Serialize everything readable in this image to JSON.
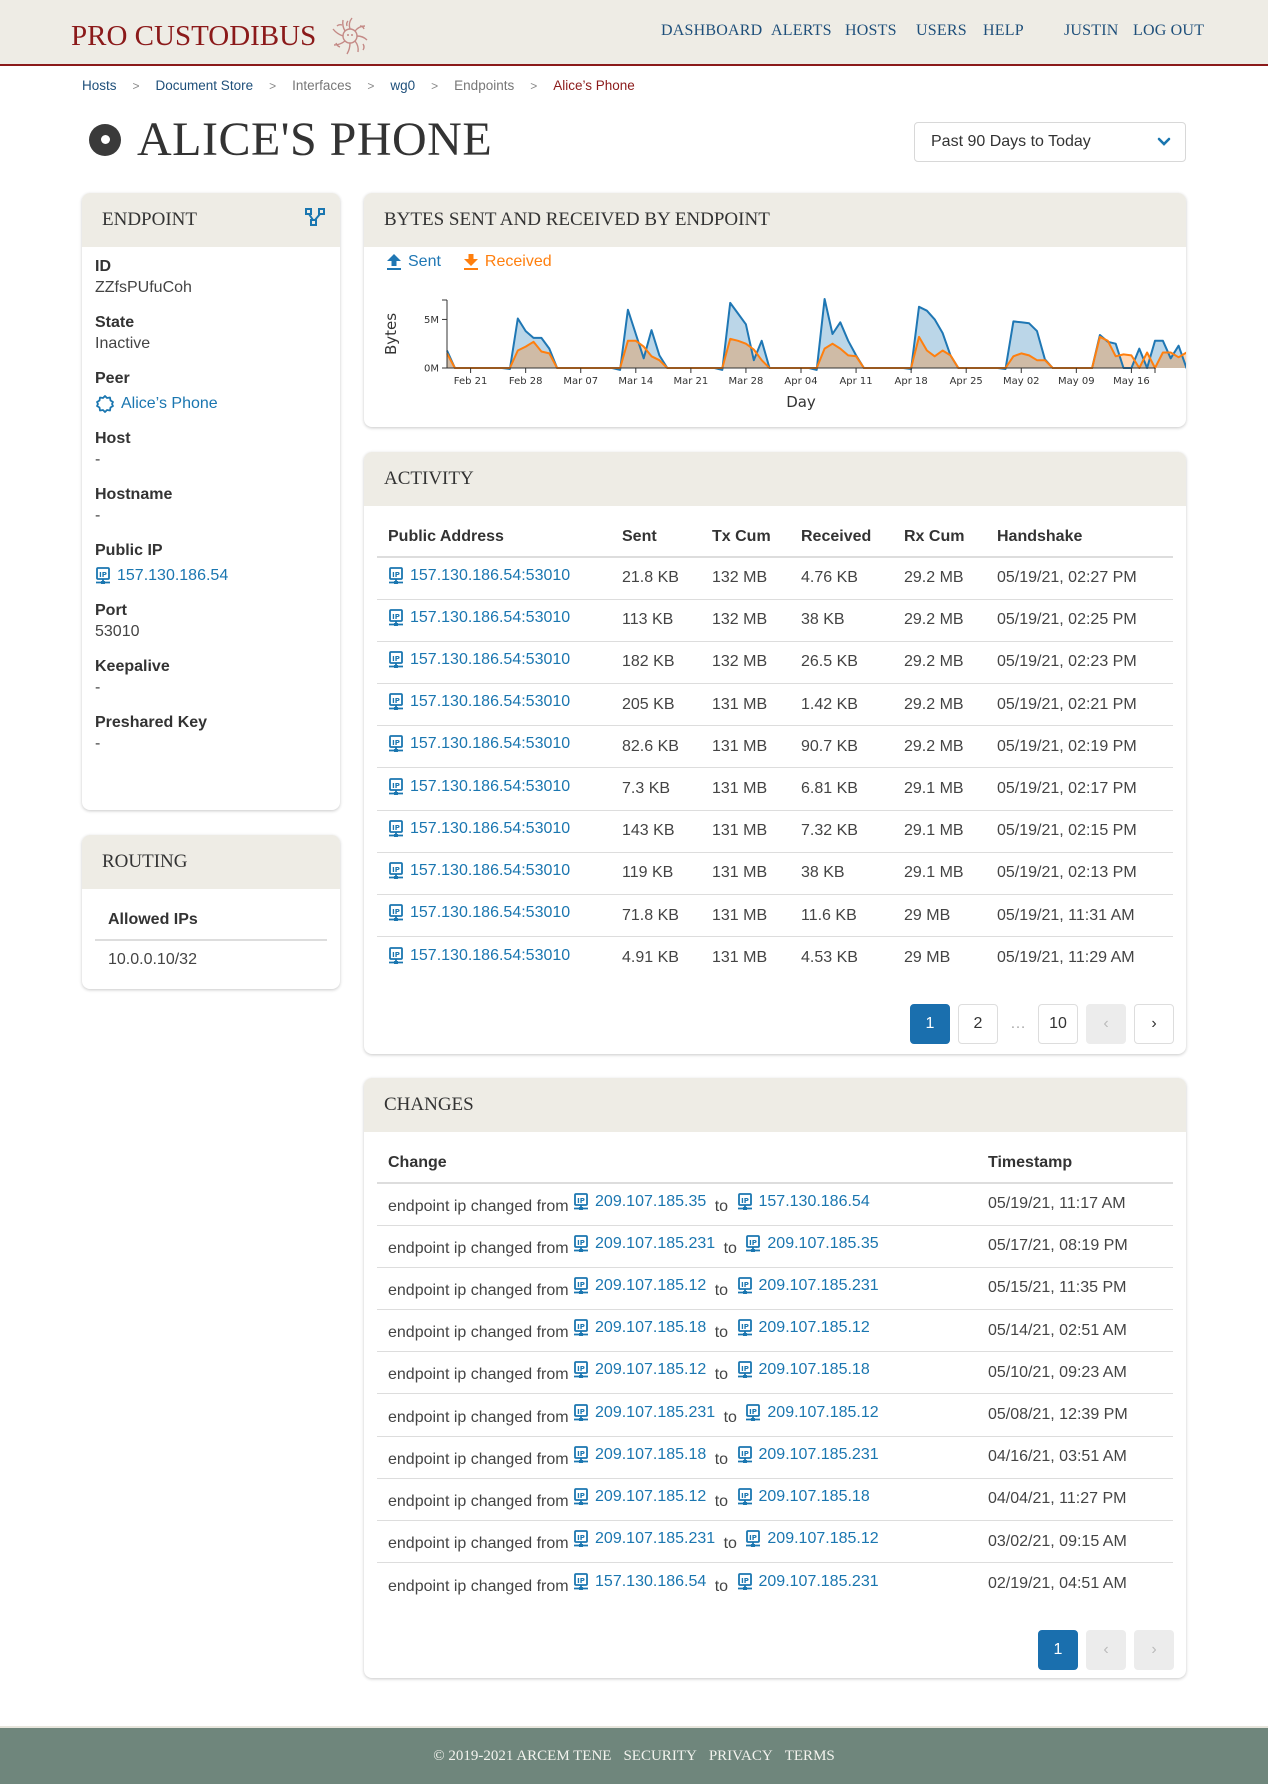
{
  "header": {
    "brand": "PRO CUSTODIBUS",
    "nav": [
      {
        "label": "DASHBOARD"
      },
      {
        "label": "ALERTS"
      },
      {
        "label": "HOSTS"
      },
      {
        "label": "USERS"
      },
      {
        "label": "HELP"
      }
    ],
    "user": "JUSTIN",
    "logout": "LOG OUT"
  },
  "breadcrumb": [
    {
      "label": "Hosts",
      "style": "link"
    },
    {
      "label": "Document Store",
      "style": "link"
    },
    {
      "label": "Interfaces",
      "style": "muted"
    },
    {
      "label": "wg0",
      "style": "link"
    },
    {
      "label": "Endpoints",
      "style": "muted"
    },
    {
      "label": "Alice’s Phone",
      "style": "current"
    }
  ],
  "breadcrumb_separator": ">",
  "page": {
    "title": "ALICE'S PHONE",
    "date_range": "Past 90 Days to Today"
  },
  "endpoint": {
    "heading": "ENDPOINT",
    "fields": {
      "id": {
        "label": "ID",
        "value": "ZZfsPUfuCoh"
      },
      "state": {
        "label": "State",
        "value": "Inactive"
      },
      "peer": {
        "label": "Peer",
        "value": "Alice’s Phone"
      },
      "host": {
        "label": "Host",
        "value": "-"
      },
      "hostname": {
        "label": "Hostname",
        "value": "-"
      },
      "public_ip": {
        "label": "Public IP",
        "value": "157.130.186.54"
      },
      "port": {
        "label": "Port",
        "value": "53010"
      },
      "keepalive": {
        "label": "Keepalive",
        "value": "-"
      },
      "preshared_key": {
        "label": "Preshared Key",
        "value": "-"
      }
    }
  },
  "routing": {
    "heading": "ROUTING",
    "column": "Allowed IPs",
    "rows": [
      "10.0.0.10/32"
    ]
  },
  "chart_panel": {
    "heading": "BYTES SENT AND RECEIVED BY ENDPOINT",
    "legend": [
      {
        "label": "Sent",
        "icon": "upload-arrow-icon",
        "color": "#1f77b4"
      },
      {
        "label": "Received",
        "icon": "download-arrow-icon",
        "color": "#ff7f0e"
      }
    ]
  },
  "chart_data": {
    "type": "area",
    "title": "BYTES SENT AND RECEIVED BY ENDPOINT",
    "xlabel": "Day",
    "ylabel": "Bytes",
    "x_start": "2021-02-18",
    "x_end": "2021-05-19",
    "x_ticks": [
      "Feb 21",
      "Feb 28",
      "Mar 07",
      "Mar 14",
      "Mar 21",
      "Mar 28",
      "Apr 04",
      "Apr 11",
      "Apr 18",
      "Apr 25",
      "May 02",
      "May 09",
      "May 16"
    ],
    "y_ticks": [
      "0M",
      "5M"
    ],
    "y_tick_values": [
      0,
      5
    ],
    "ylim": [
      0,
      7
    ],
    "y_unit": "M bytes",
    "grid": false,
    "legend_position": "top-left",
    "series": [
      {
        "name": "Sent",
        "color": "#1f77b4",
        "values": [
          1.8,
          0,
          0,
          0,
          0,
          0,
          0,
          0,
          -0.1,
          5.1,
          3.8,
          3.1,
          3.1,
          2.0,
          0,
          0,
          0,
          0,
          0,
          0,
          0,
          0,
          -0.2,
          6.0,
          3.5,
          1.0,
          3.9,
          1.3,
          0,
          0,
          0,
          0,
          0,
          0,
          0,
          -0.2,
          6.7,
          5.6,
          4.5,
          0.8,
          2.8,
          0,
          0,
          0,
          0,
          0,
          0,
          -0.2,
          7.1,
          3.5,
          4.7,
          2.8,
          1.3,
          0,
          0,
          0,
          0,
          0,
          0,
          -0.1,
          6.3,
          5.9,
          5.0,
          3.6,
          1.3,
          0,
          0,
          0,
          0,
          0,
          0,
          -0.1,
          4.8,
          4.7,
          4.6,
          3.8,
          0.9,
          0,
          0,
          0,
          0,
          0,
          0,
          3.4,
          2.7,
          2.5,
          0,
          0,
          2.0,
          0,
          2.8,
          2.8,
          1.0,
          2.3,
          0,
          2.5,
          0,
          2.1
        ]
      },
      {
        "name": "Received",
        "color": "#ff7f0e",
        "values": [
          1.5,
          0,
          0,
          0,
          0,
          0,
          0,
          0,
          0,
          1.8,
          2.2,
          2.7,
          1.7,
          1.5,
          0,
          0,
          0,
          0,
          0,
          0,
          0,
          0,
          0,
          2.8,
          2.8,
          2.2,
          1.2,
          0.8,
          0,
          0,
          0,
          0,
          0,
          0,
          0,
          0,
          3.0,
          2.8,
          2.5,
          1.9,
          0.8,
          0,
          0,
          0,
          0,
          0,
          0,
          0,
          2.0,
          2.5,
          2.0,
          1.3,
          1.2,
          0,
          0,
          0,
          0,
          0,
          0,
          0,
          3.2,
          1.8,
          1.2,
          1.8,
          1.3,
          0,
          0,
          0,
          0,
          0,
          0,
          0,
          1.2,
          1.5,
          1.3,
          0.8,
          0.8,
          0,
          0,
          0,
          0,
          0,
          0,
          3.2,
          2.8,
          1.2,
          1.4,
          1.3,
          0,
          1.6,
          0,
          1.6,
          1.6,
          1.1,
          1.6,
          0,
          1.3,
          0,
          1.4
        ]
      }
    ]
  },
  "activity": {
    "heading": "ACTIVITY",
    "columns": [
      "Public Address",
      "Sent",
      "Tx Cum",
      "Received",
      "Rx Cum",
      "Handshake"
    ],
    "rows": [
      [
        "157.130.186.54:53010",
        "21.8 KB",
        "132 MB",
        "4.76 KB",
        "29.2 MB",
        "05/19/21, 02:27 PM"
      ],
      [
        "157.130.186.54:53010",
        "113 KB",
        "132 MB",
        "38 KB",
        "29.2 MB",
        "05/19/21, 02:25 PM"
      ],
      [
        "157.130.186.54:53010",
        "182 KB",
        "132 MB",
        "26.5 KB",
        "29.2 MB",
        "05/19/21, 02:23 PM"
      ],
      [
        "157.130.186.54:53010",
        "205 KB",
        "131 MB",
        "1.42 KB",
        "29.2 MB",
        "05/19/21, 02:21 PM"
      ],
      [
        "157.130.186.54:53010",
        "82.6 KB",
        "131 MB",
        "90.7 KB",
        "29.2 MB",
        "05/19/21, 02:19 PM"
      ],
      [
        "157.130.186.54:53010",
        "7.3 KB",
        "131 MB",
        "6.81 KB",
        "29.1 MB",
        "05/19/21, 02:17 PM"
      ],
      [
        "157.130.186.54:53010",
        "143 KB",
        "131 MB",
        "7.32 KB",
        "29.1 MB",
        "05/19/21, 02:15 PM"
      ],
      [
        "157.130.186.54:53010",
        "119 KB",
        "131 MB",
        "38 KB",
        "29.1 MB",
        "05/19/21, 02:13 PM"
      ],
      [
        "157.130.186.54:53010",
        "71.8 KB",
        "131 MB",
        "11.6 KB",
        "29 MB",
        "05/19/21, 11:31 AM"
      ],
      [
        "157.130.186.54:53010",
        "4.91 KB",
        "131 MB",
        "4.53 KB",
        "29 MB",
        "05/19/21, 11:29 AM"
      ]
    ],
    "pagination": {
      "pages": [
        "1",
        "2",
        "…",
        "10"
      ],
      "current": "1",
      "prev": "‹",
      "next": "›",
      "prev_disabled": true,
      "next_disabled": false
    }
  },
  "changes": {
    "heading": "CHANGES",
    "columns": [
      "Change",
      "Timestamp"
    ],
    "text_prefix": "endpoint ip changed from",
    "text_middle": "to",
    "rows": [
      {
        "from": "209.107.185.35",
        "to": "157.130.186.54",
        "timestamp": "05/19/21, 11:17 AM"
      },
      {
        "from": "209.107.185.231",
        "to": "209.107.185.35",
        "timestamp": "05/17/21, 08:19 PM"
      },
      {
        "from": "209.107.185.12",
        "to": "209.107.185.231",
        "timestamp": "05/15/21, 11:35 PM"
      },
      {
        "from": "209.107.185.18",
        "to": "209.107.185.12",
        "timestamp": "05/14/21, 02:51 AM"
      },
      {
        "from": "209.107.185.12",
        "to": "209.107.185.18",
        "timestamp": "05/10/21, 09:23 AM"
      },
      {
        "from": "209.107.185.231",
        "to": "209.107.185.12",
        "timestamp": "05/08/21, 12:39 PM"
      },
      {
        "from": "209.107.185.18",
        "to": "209.107.185.231",
        "timestamp": "04/16/21, 03:51 AM"
      },
      {
        "from": "209.107.185.12",
        "to": "209.107.185.18",
        "timestamp": "04/04/21, 11:27 PM"
      },
      {
        "from": "209.107.185.231",
        "to": "209.107.185.12",
        "timestamp": "03/02/21, 09:15 AM"
      },
      {
        "from": "157.130.186.54",
        "to": "209.107.185.231",
        "timestamp": "02/19/21, 04:51 AM"
      }
    ],
    "pagination": {
      "pages": [
        "1"
      ],
      "current": "1",
      "prev": "‹",
      "next": "›",
      "prev_disabled": true,
      "next_disabled": true
    }
  },
  "footer": {
    "copyright": "© 2019-2021 ARCEM TENE",
    "links": [
      "SECURITY",
      "PRIVACY",
      "TERMS"
    ]
  },
  "colors": {
    "brand": "#8b1a1a",
    "link": "#1a76b0",
    "nav": "#1e4f7a",
    "header_bg": "#eeece5",
    "footer_bg": "#6f867c",
    "active_page": "#1a6fae",
    "sent": "#1f77b4",
    "received": "#ff7f0e"
  }
}
